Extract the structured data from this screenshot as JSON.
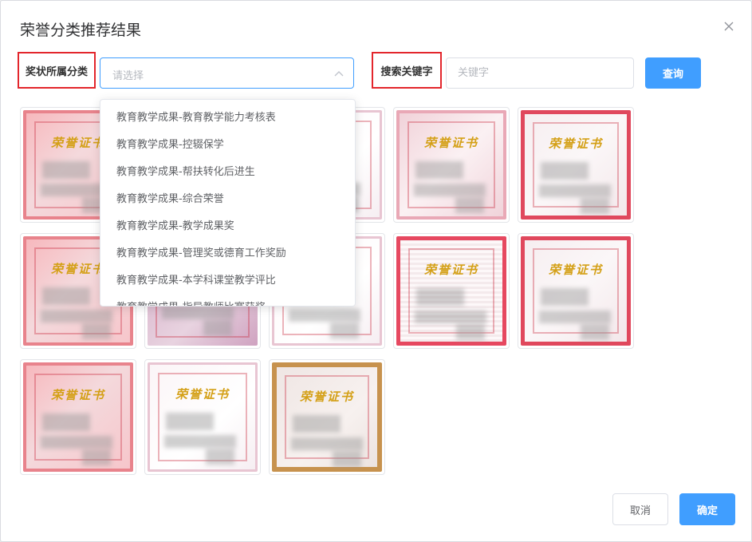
{
  "dialog": {
    "title": "荣誉分类推荐结果"
  },
  "filters": {
    "category_label": "奖状所属分类",
    "category_placeholder": "请选择",
    "keyword_label": "搜索关键字",
    "keyword_placeholder": "关键字",
    "keyword_value": "",
    "search_button": "查询"
  },
  "dropdown": {
    "options": [
      "教育教学成果-教育教学能力考核表",
      "教育教学成果-控辍保学",
      "教育教学成果-帮扶转化后进生",
      "教育教学成果-综合荣誉",
      "教育教学成果-教学成果奖",
      "教育教学成果-管理奖或德育工作奖励",
      "教育教学成果-本学科课堂教学评比",
      "教育教学成果-指导教师比赛获奖"
    ]
  },
  "certificates": [
    {
      "heading": "荣誉证书"
    },
    {
      "heading": ""
    },
    {
      "heading": ""
    },
    {
      "heading": "荣誉证书"
    },
    {
      "heading": "荣誉证书"
    },
    {
      "heading": "荣誉证书"
    },
    {
      "heading": ""
    },
    {
      "heading": ""
    },
    {
      "heading": "荣誉证书"
    },
    {
      "heading": "荣誉证书"
    },
    {
      "heading": "荣誉证书"
    },
    {
      "heading": "荣誉证书"
    },
    {
      "heading": "荣誉证书"
    }
  ],
  "footer": {
    "cancel": "取消",
    "confirm": "确定"
  },
  "colors": {
    "primary": "#409eff",
    "highlight_border": "#e3262c"
  }
}
